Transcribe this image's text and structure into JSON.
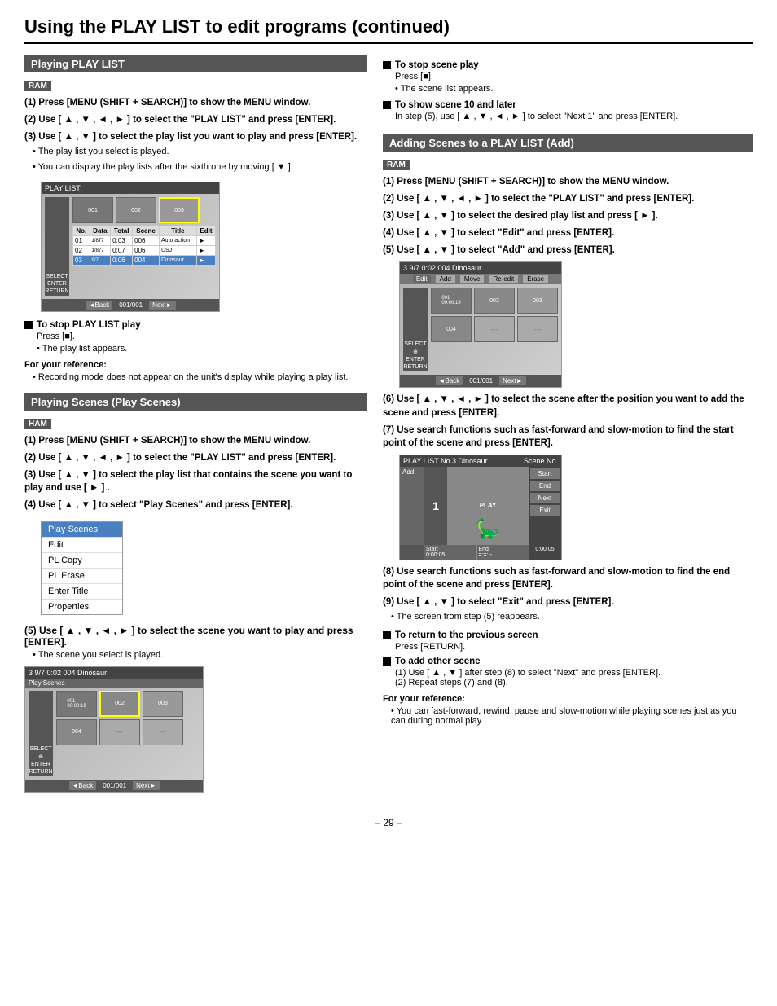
{
  "page": {
    "title": "Using the PLAY LIST to edit programs (continued)",
    "page_number": "– 29 –"
  },
  "left_column": {
    "section1": {
      "header": "Playing PLAY LIST",
      "badge": "RAM",
      "steps": [
        "(1) Press [MENU (SHIFT + SEARCH)] to show the MENU window.",
        "(2) Use [ ▲ , ▼ , ◄ , ► ] to select the \"PLAY LIST\" and press [ENTER].",
        "(3) Use [ ▲ , ▼ ] to select the play list you want to play and press [ENTER]."
      ],
      "step3_notes": [
        "The play list you select is played.",
        "You can display the play lists after the sixth one by moving [ ▼ ]."
      ],
      "stop_title": "To stop PLAY LIST play",
      "stop_text": "Press [■].",
      "stop_note": "The play list appears.",
      "reference_title": "For your reference:",
      "reference_note": "Recording mode does not appear on the unit's display while playing a play list."
    },
    "section2": {
      "header": "Playing Scenes (Play Scenes)",
      "badge": "HAM",
      "steps": [
        "(1) Press [MENU (SHIFT + SEARCH)] to show the MENU window.",
        "(2) Use [ ▲ , ▼ , ◄ , ► ] to select the \"PLAY LIST\" and press [ENTER].",
        "(3) Use [ ▲ , ▼ ] to select the play list that contains the scene you want to play and use [ ► ] .",
        "(4) Use [ ▲ , ▼ ] to select \"Play Scenes\" and press [ENTER]."
      ],
      "menu_items": [
        {
          "label": "Play Scenes",
          "selected": true
        },
        {
          "label": "Edit",
          "selected": false
        },
        {
          "label": "PL Copy",
          "selected": false
        },
        {
          "label": "PL Erase",
          "selected": false
        },
        {
          "label": "Enter Title",
          "selected": false
        },
        {
          "label": "Properties",
          "selected": false
        }
      ],
      "step5": "(5) Use [ ▲ , ▼ , ◄ , ► ] to select the scene you want to play and press [ENTER].",
      "step5_note": "The scene you select is played."
    }
  },
  "right_column": {
    "section1": {
      "stop_play_title": "To stop scene play",
      "stop_play_text": "Press [■].",
      "stop_play_note": "The scene list appears.",
      "show_scene_title": "To show scene 10 and later",
      "show_scene_text": "In step (5), use [ ▲ , ▼ , ◄ , ► ] to select \"Next 1\" and press [ENTER]."
    },
    "section2": {
      "header": "Adding Scenes to a PLAY LIST (Add)",
      "badge": "RAM",
      "steps": [
        "(1) Press [MENU (SHIFT + SEARCH)] to show the MENU window.",
        "(2) Use [ ▲ , ▼ , ◄ , ► ] to select the \"PLAY LIST\" and press [ENTER].",
        "(3) Use [ ▲ , ▼ ] to select the desired play list and press [ ► ].",
        "(4) Use [ ▲ , ▼ ] to select \"Edit\" and press [ENTER].",
        "(5) Use [ ▲ , ▼ ] to select \"Add\" and press [ENTER].",
        "(6) Use [ ▲ , ▼ , ◄ , ► ] to select the scene after the position you want to add the scene and press [ENTER].",
        "(7) Use search functions such as fast-forward and slow-motion to find the start point of the scene and press [ENTER].",
        "(8) Use search functions such as fast-forward and slow-motion to find the end point of the scene and press [ENTER].",
        "(9) Use [ ▲ , ▼ ] to select \"Exit\" and press [ENTER]."
      ],
      "step9_note": "The screen from step (5) reappears.",
      "return_title": "To return to the previous screen",
      "return_text": "Press [RETURN].",
      "add_other_title": "To add other scene",
      "add_other_steps": [
        "(1) Use [ ▲ , ▼ ] after step (8) to select \"Next\" and press [ENTER].",
        "(2) Repeat steps (7) and (8)."
      ],
      "reference_title": "For your reference:",
      "reference_note": "You can fast-forward, rewind, pause and slow-motion while playing scenes just as you can during normal play."
    }
  },
  "screens": {
    "play_list_screen": {
      "title": "PLAY LIST",
      "table_headers": [
        "No.",
        "Data",
        "Total",
        "Scene",
        "Title",
        "Edit"
      ],
      "table_rows": [
        [
          "01",
          "1/877",
          "0:03",
          "006",
          "Auto action",
          "►"
        ],
        [
          "02",
          "1/877",
          "0:07",
          "006",
          "USJ",
          "►"
        ],
        [
          "03",
          "9/7",
          "0:06",
          "004",
          "Dinosaur",
          "►"
        ]
      ],
      "nav_back": "◄Back",
      "nav_page": "001/001",
      "nav_next": "Next►"
    },
    "play_scenes_screen": {
      "title": "3  9/7 0:02 004  Dinosaur",
      "subtitle": "Play Scenes",
      "thumbnails": [
        {
          "id": "001",
          "time": "00:00:19"
        },
        {
          "id": "002",
          "empty": false
        },
        {
          "id": "003",
          "empty": false
        },
        {
          "id": "004",
          "empty": false
        },
        {
          "id": "---",
          "empty": true
        },
        {
          "id": "---",
          "empty": true
        }
      ],
      "nav_back": "◄Back",
      "nav_page": "001/001",
      "nav_next": "Next►"
    },
    "add_screen": {
      "title": "3  9/7 0:02 004  Dinosaur",
      "buttons": [
        "Add",
        "Move",
        "Re-edit",
        "Erase"
      ],
      "thumbnails": [
        {
          "id": "001",
          "time": "00:00:19"
        },
        {
          "id": "002",
          "empty": false
        },
        {
          "id": "003",
          "empty": false
        },
        {
          "id": "004",
          "empty": false
        },
        {
          "id": "---",
          "empty": true
        },
        {
          "id": "---",
          "empty": true
        }
      ],
      "nav_back": "◄Back",
      "nav_page": "001/001",
      "nav_next": "Next►"
    },
    "scene_play_screen": {
      "title": "PLAY LIST No.3 Dinosaur",
      "subtitle": "Add",
      "scene_no_label": "Scene No.",
      "scene_no": "1",
      "buttons": [
        "Start",
        "End",
        "Next",
        "Exit"
      ],
      "time_label": "0:00:05",
      "start_label": "Start",
      "end_label": "End",
      "start_time": "0:00:05",
      "end_time": "=:=:--"
    }
  }
}
